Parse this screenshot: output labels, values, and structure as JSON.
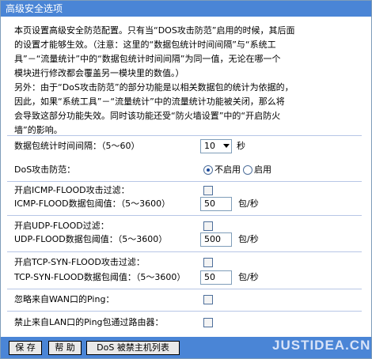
{
  "title": "高级安全选项",
  "intro": {
    "line1": "本页设置高级安全防范配置。只有当“DOS攻击防范”启用的时候，其后面",
    "line2": "的设置才能够生效。（注意：这里的“数据包统计时间间隔”与“系统工",
    "line3": "具”－“流量统计”中的“数据包统计时间间隔”为同一值，无论在哪一个",
    "line4": "模块进行修改都会覆盖另一模块里的数值。）",
    "line5": "另外：由于“DoS攻击防范”的部分功能是以相关数据包的统计为依据的，",
    "line6": "因此，如果“系统工具”－“流量统计”中的流量统计功能被关闭，那么将",
    "line7": "会导致这部分功能失效。同时该功能还受“防火墙设置”中的“开启防火",
    "line8": "墙”的影响。"
  },
  "interval": {
    "label": "数据包统计时间间隔：（5～60）",
    "value": "10",
    "unit": "秒"
  },
  "dos": {
    "label": "DoS攻击防范：",
    "option_off": "不启用",
    "option_on": "启用",
    "selected": "off"
  },
  "icmp": {
    "enable_label": "开启ICMP-FLOOD攻击过滤：",
    "threshold_label": "ICMP-FLOOD数据包阈值：（5～3600）",
    "value": "50",
    "unit": "包/秒",
    "checked": false
  },
  "udp": {
    "enable_label": "开启UDP-FLOOD过滤：",
    "threshold_label": "UDP-FLOOD数据包阈值：（5～3600）",
    "value": "500",
    "unit": "包/秒",
    "checked": false
  },
  "tcp": {
    "enable_label": "开启TCP-SYN-FLOOD攻击过滤：",
    "threshold_label": "TCP-SYN-FLOOD数据包阈值：（5～3600）",
    "value": "50",
    "unit": "包/秒",
    "checked": false
  },
  "wan_ping": {
    "label": "忽略来自WAN口的Ping：",
    "checked": false
  },
  "lan_ping": {
    "label": "禁止来自LAN口的Ping包通过路由器：",
    "checked": false
  },
  "buttons": {
    "save": "保 存",
    "help": "帮 助",
    "blacklist": "DoS 被禁主机列表"
  },
  "watermark": "JUSTIDEA.CN",
  "colors": {
    "titlebar": "#4a85d6",
    "border": "#7f9db9"
  }
}
